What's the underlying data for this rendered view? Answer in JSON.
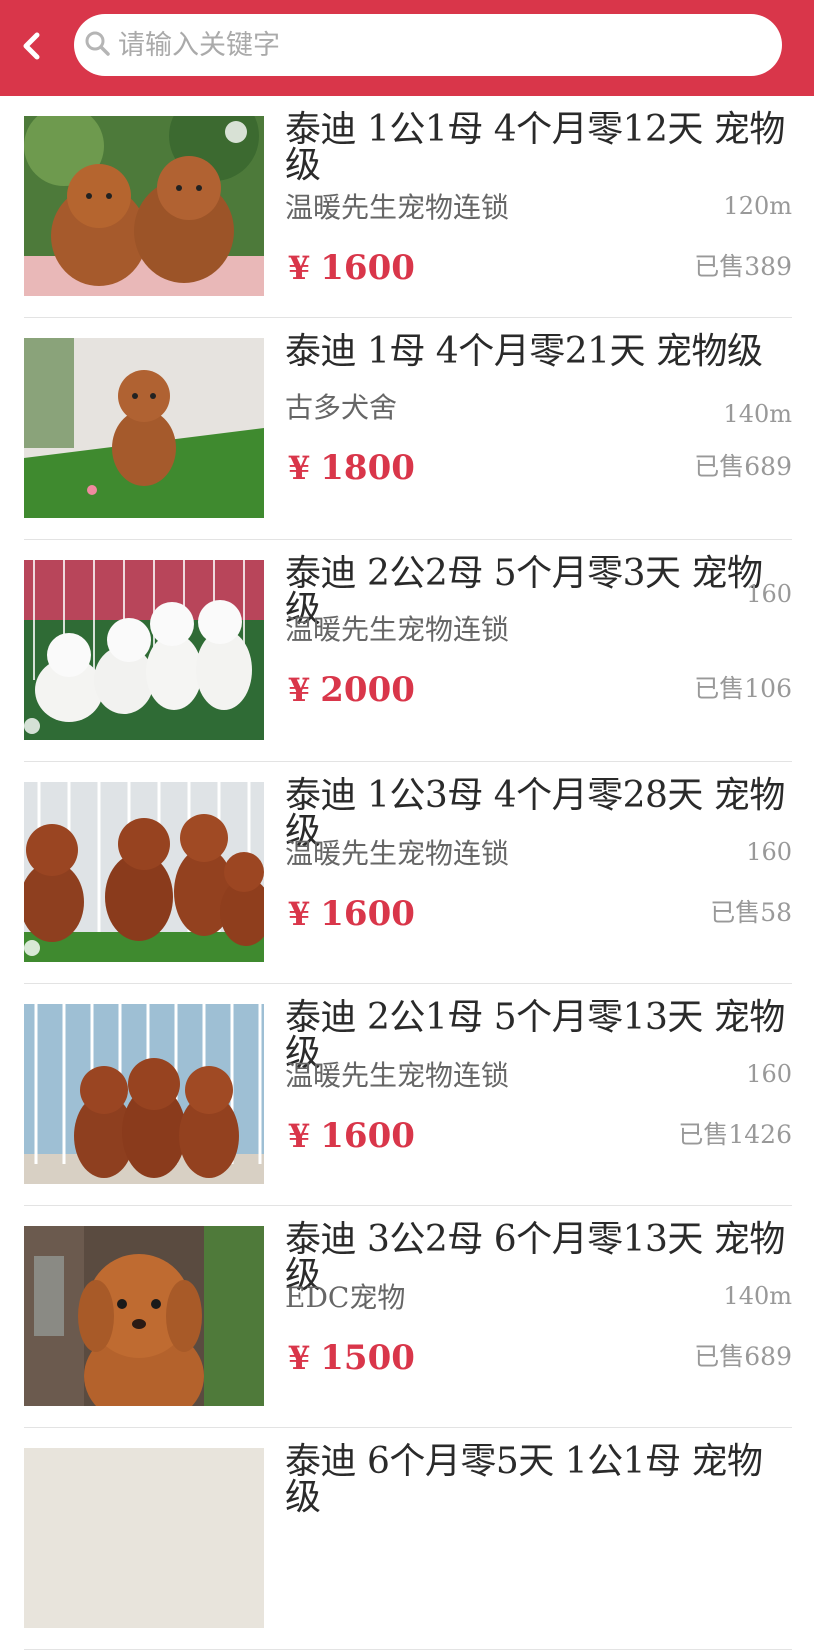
{
  "search": {
    "placeholder": "请输入关键字",
    "value": ""
  },
  "theme": {
    "accent": "#d9364a",
    "price": "#d9364a"
  },
  "items": [
    {
      "title": "泰迪 1公1母 4个月零12天 宠物级",
      "shop": "温暖先生宠物连锁",
      "distance": "120m",
      "currency": "¥",
      "price": "1600",
      "sold": "已售389",
      "photo": "two-red-poodles-pink-blanket"
    },
    {
      "title": "泰迪 1母 4个月零21天 宠物级",
      "shop": "古多犬舍",
      "distance": "140m",
      "currency": "¥",
      "price": "1800",
      "sold": "已售689",
      "photo": "red-poodle-on-grass"
    },
    {
      "title": "泰迪 2公2母 5个月零3天 宠物级",
      "shop": "温暖先生宠物连锁",
      "distance": "160",
      "currency": "¥",
      "price": "2000",
      "sold": "已售106",
      "photo": "four-white-poodles-fence"
    },
    {
      "title": "泰迪 1公3母 4个月零28天 宠物级",
      "shop": "温暖先生宠物连锁",
      "distance": "160",
      "currency": "¥",
      "price": "1600",
      "sold": "已售58",
      "photo": "four-red-poodles-fence"
    },
    {
      "title": "泰迪 2公1母 5个月零13天 宠物级",
      "shop": "温暖先生宠物连锁",
      "distance": "160",
      "currency": "¥",
      "price": "1600",
      "sold": "已售1426",
      "photo": "three-red-poodles-fence"
    },
    {
      "title": "泰迪 3公2母 6个月零13天 宠物级",
      "shop": "EDC宠物",
      "distance": "140m",
      "currency": "¥",
      "price": "1500",
      "sold": "已售689",
      "photo": "red-poodle-closeup"
    },
    {
      "title": "泰迪 6个月零5天 1公1母 宠物级",
      "shop": "",
      "distance": "",
      "currency": "",
      "price": "",
      "sold": "",
      "photo": "partial"
    }
  ]
}
